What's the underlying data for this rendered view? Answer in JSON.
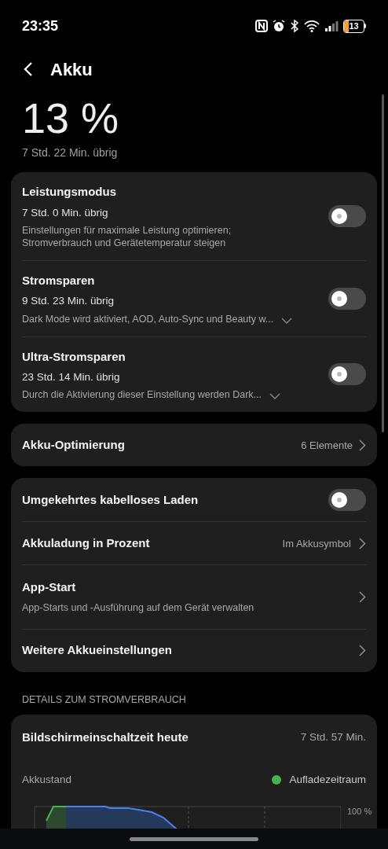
{
  "status_bar": {
    "time": "23:35",
    "battery": "13"
  },
  "header": {
    "title": "Akku"
  },
  "battery": {
    "percent": "13 %",
    "remaining": "7 Std. 22 Min. übrig"
  },
  "power_modes": [
    {
      "title": "Leistungsmodus",
      "remaining": "7 Std. 0 Min. übrig",
      "description": "Einstellungen für maximale Leistung optimieren; Stromverbrauch und Gerätetemperatur steigen",
      "expandable": false,
      "on": false
    },
    {
      "title": "Stromsparen",
      "remaining": "9 Std. 23 Min. übrig",
      "description": "Dark Mode wird aktiviert, AOD, Auto-Sync und Beauty w...",
      "expandable": true,
      "on": false
    },
    {
      "title": "Ultra-Stromsparen",
      "remaining": "23 Std. 14 Min. übrig",
      "description": "Durch die Aktivierung dieser Einstellung werden Dark...",
      "expandable": true,
      "on": false
    }
  ],
  "optimization": {
    "title": "Akku-Optimierung",
    "value": "6 Elemente"
  },
  "settings": [
    {
      "kind": "toggle",
      "title": "Umgekehrtes kabelloses Laden",
      "on": false
    },
    {
      "kind": "link",
      "title": "Akkuladung in Prozent",
      "value": "Im Akkusymbol"
    },
    {
      "kind": "link",
      "title": "App-Start",
      "subtitle": "App-Starts und -Ausführung auf dem Gerät verwalten"
    },
    {
      "kind": "link",
      "title": "Weitere Akkueinstellungen"
    }
  ],
  "usage": {
    "section_title": "DETAILS ZUM STROMVERBRAUCH",
    "screen_time_label": "Bildschirmeinschaltzeit heute",
    "screen_time": "7 Std. 57 Min.",
    "chart_title": "Akkustand",
    "legend": {
      "label": "Aufladezeitraum",
      "color": "#4caf50"
    },
    "axis_label": "100 %"
  }
}
